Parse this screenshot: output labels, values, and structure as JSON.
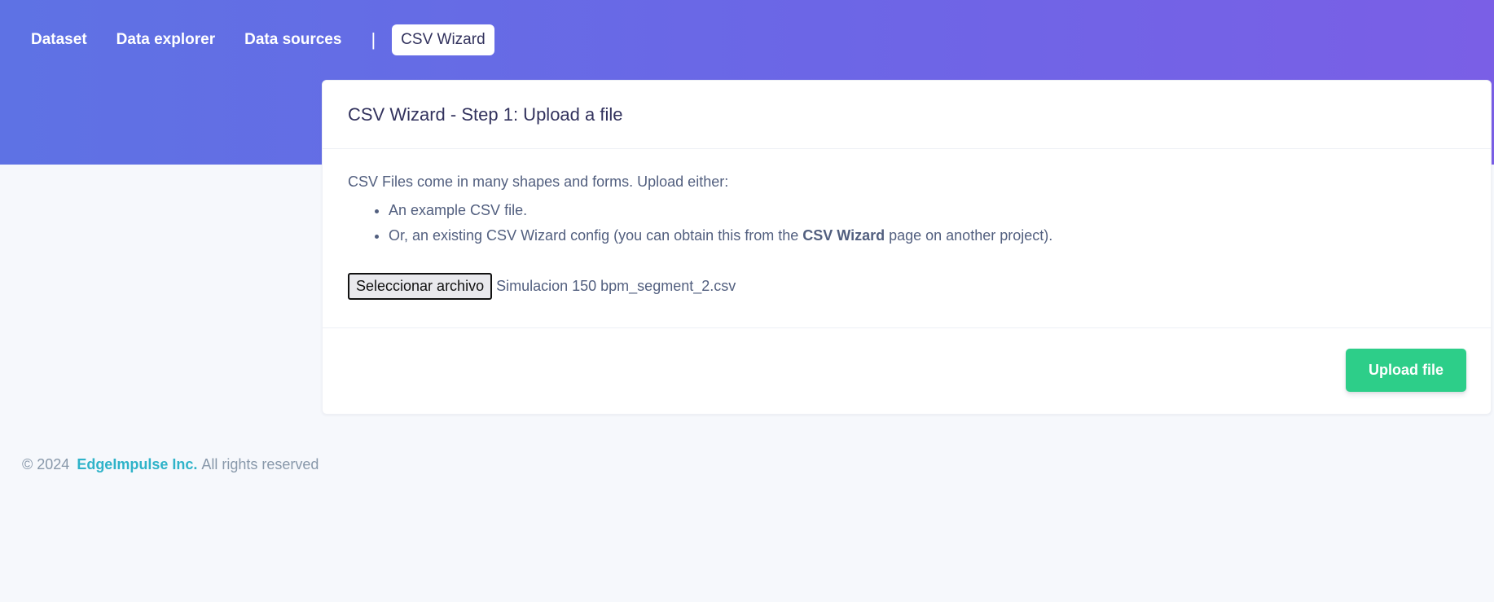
{
  "nav": {
    "items": [
      {
        "label": "Dataset"
      },
      {
        "label": "Data explorer"
      },
      {
        "label": "Data sources"
      }
    ],
    "separator": "|",
    "active": {
      "label": "CSV Wizard"
    }
  },
  "card": {
    "title": "CSV Wizard - Step 1: Upload a file",
    "intro": "CSV Files come in many shapes and forms. Upload either:",
    "bullets": {
      "first": "An example CSV file.",
      "second_before": "Or, an existing CSV Wizard config (you can obtain this from the ",
      "second_bold": "CSV Wizard",
      "second_after": " page on another project)."
    },
    "file_input": {
      "button_label": "Seleccionar archivo",
      "file_name": "Simulacion 150 bpm_segment_2.csv"
    },
    "upload_label": "Upload file"
  },
  "footer": {
    "copyright": "© 2024",
    "brand": "EdgeImpulse Inc.",
    "rights": "All rights reserved"
  },
  "colors": {
    "header_gradient_start": "#5e72e4",
    "header_gradient_end": "#7a5fe6",
    "upload_button": "#2dce89",
    "brand_link": "#2fb3c9"
  }
}
